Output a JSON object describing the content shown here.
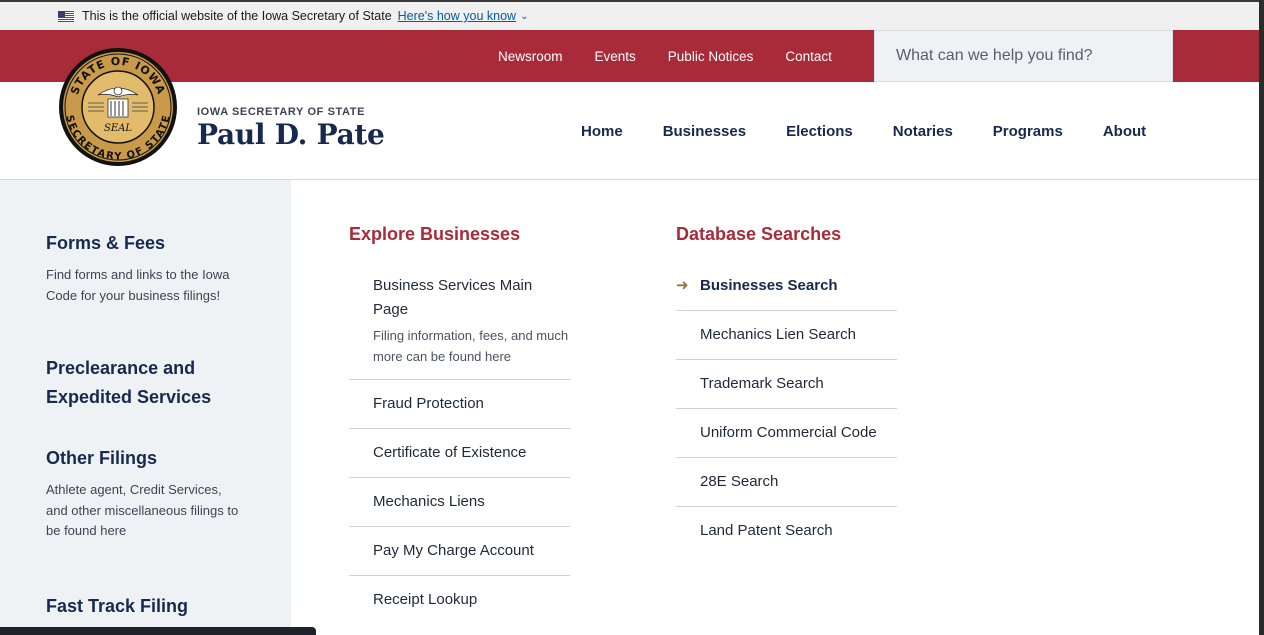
{
  "gov_banner": {
    "text": "This is the official website of the Iowa Secretary of State",
    "link": "Here's how you know"
  },
  "utility_nav": [
    "Newsroom",
    "Events",
    "Public Notices",
    "Contact"
  ],
  "search": {
    "placeholder": "What can we help you find?"
  },
  "header": {
    "eyebrow": "IOWA SECRETARY OF STATE",
    "name": "Paul D. Pate",
    "seal_text": {
      "top": "STATE OF IOWA",
      "bottom": "SECRETARY OF STATE",
      "center": "SEAL"
    }
  },
  "main_nav": [
    "Home",
    "Businesses",
    "Elections",
    "Notaries",
    "Programs",
    "About"
  ],
  "sidebar": [
    {
      "title": "Forms & Fees",
      "desc": "Find forms and links to the Iowa Code for your business filings!"
    },
    {
      "title": "Preclearance and Expedited Services",
      "desc": ""
    },
    {
      "title": "Other Filings",
      "desc": "Athlete agent, Credit Services, and other miscellaneous filings to be found here"
    },
    {
      "title": "Fast Track Filing",
      "desc": ""
    }
  ],
  "explore": {
    "title": "Explore Businesses",
    "items": [
      {
        "label": "Business Services Main Page",
        "desc": "Filing information, fees, and much more can be found here"
      },
      {
        "label": "Fraud Protection"
      },
      {
        "label": "Certificate of Existence"
      },
      {
        "label": "Mechanics Liens"
      },
      {
        "label": "Pay My Charge Account"
      },
      {
        "label": "Receipt Lookup"
      }
    ]
  },
  "database": {
    "title": "Database Searches",
    "items": [
      {
        "label": "Businesses Search",
        "active": true
      },
      {
        "label": "Mechanics Lien Search"
      },
      {
        "label": "Trademark Search"
      },
      {
        "label": "Uniform Commercial Code"
      },
      {
        "label": "28E Search"
      },
      {
        "label": "Land Patent Search"
      }
    ]
  },
  "colors": {
    "brand_red": "#a92a39",
    "navy": "#17294c",
    "sidebar_bg": "#eef2f5",
    "seal_gold": "#c89a4a"
  }
}
